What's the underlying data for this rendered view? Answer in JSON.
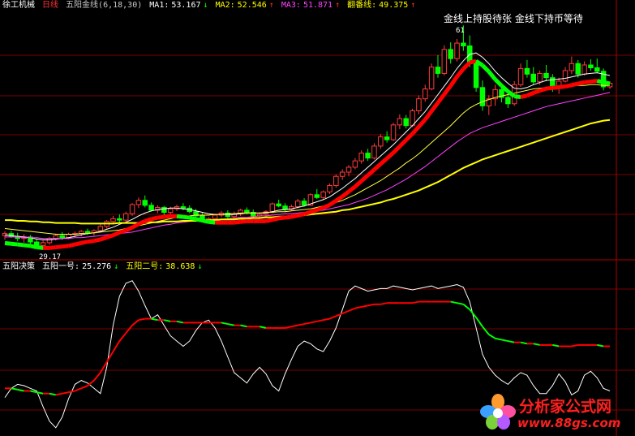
{
  "header_main": {
    "stock_name": "徐工机械",
    "period": "日线",
    "indicator": "五阳金线(6,18,30)",
    "ma1_label": "MA1:",
    "ma1_value": "53.167",
    "ma1_arrow": "↓",
    "ma2_label": "MA2:",
    "ma2_value": "52.546",
    "ma2_arrow": "↑",
    "ma3_label": "MA3:",
    "ma3_value": "51.871",
    "ma3_arrow": "↑",
    "fan_label": "翻番线:",
    "fan_value": "49.375",
    "fan_arrow": "↑"
  },
  "header_sub": {
    "indicator": "五阳决策",
    "line1_label": "五阳一号:",
    "line1_value": "25.276",
    "line1_arrow": "↓",
    "line2_label": "五阳二号:",
    "line2_value": "38.638",
    "line2_arrow": "↓"
  },
  "annotation": "金线上持股待张  金线下持币等待",
  "price_high_label": "61",
  "price_low_label": "29.17",
  "brand": {
    "name": "分析家公式网",
    "url": "www.88gs.com"
  },
  "colors": {
    "bg": "#000000",
    "up": "#ff3b3b",
    "down": "#00ff00",
    "gold_up": "#ff0000",
    "gold_down": "#00ff00",
    "ma1": "#ffffff",
    "ma2": "#ffff40",
    "ma3": "#ff40ff",
    "fan": "#ffff00",
    "grid": "#7a0000",
    "sub_white": "#ffffff"
  },
  "chart_data": [
    {
      "type": "candlestick",
      "title": "五阳金线(6,18,30)",
      "ylim": [
        28,
        63
      ],
      "grid": true,
      "candles": [
        [
          31.2,
          31.8,
          30.6,
          31.5
        ],
        [
          31.5,
          31.9,
          30.9,
          31.1
        ],
        [
          31.1,
          31.6,
          30.4,
          30.8
        ],
        [
          30.8,
          31.4,
          30.2,
          31.0
        ],
        [
          31.0,
          31.3,
          29.9,
          30.3
        ],
        [
          30.3,
          30.7,
          29.5,
          29.8
        ],
        [
          29.8,
          30.5,
          29.2,
          30.2
        ],
        [
          30.2,
          31.0,
          29.9,
          30.8
        ],
        [
          30.8,
          31.5,
          30.5,
          31.2
        ],
        [
          31.2,
          31.7,
          30.6,
          30.9
        ],
        [
          30.9,
          31.6,
          30.7,
          31.4
        ],
        [
          31.4,
          31.8,
          31.0,
          31.5
        ],
        [
          31.5,
          32.0,
          31.1,
          31.8
        ],
        [
          31.8,
          32.2,
          31.3,
          31.6
        ],
        [
          31.6,
          32.1,
          31.2,
          31.9
        ],
        [
          31.9,
          32.8,
          31.7,
          32.5
        ],
        [
          32.5,
          33.4,
          32.2,
          33.2
        ],
        [
          33.2,
          34.0,
          32.8,
          33.6
        ],
        [
          33.6,
          34.2,
          33.0,
          33.4
        ],
        [
          33.4,
          34.6,
          33.2,
          34.3
        ],
        [
          34.3,
          35.8,
          34.0,
          35.6
        ],
        [
          35.6,
          36.6,
          35.1,
          36.2
        ],
        [
          36.2,
          36.9,
          35.2,
          35.5
        ],
        [
          35.5,
          35.9,
          34.6,
          34.8
        ],
        [
          34.8,
          35.5,
          34.4,
          35.2
        ],
        [
          35.2,
          35.4,
          34.1,
          34.5
        ],
        [
          34.5,
          35.3,
          34.2,
          35.0
        ],
        [
          35.0,
          35.6,
          34.7,
          35.3
        ],
        [
          35.3,
          35.8,
          34.8,
          35.1
        ],
        [
          35.1,
          35.5,
          34.4,
          34.6
        ],
        [
          34.6,
          35.0,
          33.8,
          34.0
        ],
        [
          34.0,
          34.4,
          33.1,
          33.4
        ],
        [
          33.4,
          33.8,
          32.9,
          33.6
        ],
        [
          33.6,
          34.3,
          33.3,
          34.1
        ],
        [
          34.1,
          34.7,
          33.8,
          34.4
        ],
        [
          34.4,
          34.8,
          33.7,
          33.9
        ],
        [
          33.9,
          34.6,
          33.6,
          34.3
        ],
        [
          34.3,
          35.0,
          34.0,
          34.8
        ],
        [
          34.8,
          35.2,
          34.2,
          34.5
        ],
        [
          34.5,
          34.9,
          33.8,
          34.0
        ],
        [
          34.0,
          34.5,
          33.6,
          34.2
        ],
        [
          34.2,
          34.8,
          33.9,
          34.6
        ],
        [
          34.6,
          35.9,
          34.4,
          35.7
        ],
        [
          35.7,
          36.3,
          35.2,
          35.4
        ],
        [
          35.4,
          35.8,
          34.6,
          34.9
        ],
        [
          34.9,
          35.6,
          34.7,
          35.3
        ],
        [
          35.3,
          36.4,
          35.1,
          36.1
        ],
        [
          36.1,
          36.5,
          35.3,
          35.5
        ],
        [
          35.5,
          37.2,
          35.4,
          37.0
        ],
        [
          37.0,
          37.8,
          36.4,
          36.6
        ],
        [
          36.6,
          37.6,
          36.3,
          37.4
        ],
        [
          37.4,
          38.6,
          37.1,
          38.3
        ],
        [
          38.3,
          39.9,
          38.0,
          39.6
        ],
        [
          39.6,
          40.6,
          39.1,
          40.2
        ],
        [
          40.2,
          41.2,
          39.6,
          40.9
        ],
        [
          40.9,
          42.2,
          40.6,
          41.8
        ],
        [
          41.8,
          43.3,
          41.4,
          42.9
        ],
        [
          42.9,
          43.5,
          41.8,
          42.2
        ],
        [
          42.2,
          44.3,
          42.0,
          43.9
        ],
        [
          43.9,
          45.6,
          43.5,
          45.2
        ],
        [
          45.2,
          46.0,
          44.4,
          44.8
        ],
        [
          44.8,
          47.2,
          44.6,
          46.9
        ],
        [
          46.9,
          48.4,
          46.3,
          47.8
        ],
        [
          47.8,
          48.3,
          46.4,
          46.8
        ],
        [
          46.8,
          49.2,
          46.6,
          48.9
        ],
        [
          48.9,
          51.1,
          48.4,
          50.6
        ],
        [
          50.6,
          52.6,
          50.2,
          52.0
        ],
        [
          52.0,
          55.6,
          51.8,
          55.1
        ],
        [
          55.1,
          56.8,
          53.6,
          54.2
        ],
        [
          54.2,
          58.2,
          53.9,
          57.6
        ],
        [
          57.6,
          58.6,
          55.6,
          56.3
        ],
        [
          56.3,
          59.1,
          55.9,
          58.5
        ],
        [
          58.5,
          61.0,
          57.4,
          58.1
        ],
        [
          58.1,
          59.6,
          55.1,
          55.6
        ],
        [
          55.6,
          56.1,
          51.6,
          52.2
        ],
        [
          52.2,
          53.2,
          48.9,
          49.6
        ],
        [
          49.6,
          51.1,
          48.3,
          50.6
        ],
        [
          50.6,
          52.6,
          49.6,
          51.9
        ],
        [
          51.9,
          52.3,
          50.1,
          50.8
        ],
        [
          50.8,
          51.6,
          49.3,
          49.9
        ],
        [
          49.9,
          53.1,
          49.6,
          52.6
        ],
        [
          52.6,
          55.6,
          52.3,
          54.9
        ],
        [
          54.9,
          56.1,
          53.6,
          54.1
        ],
        [
          54.1,
          55.1,
          52.6,
          53.0
        ],
        [
          53.0,
          54.6,
          52.6,
          54.2
        ],
        [
          54.2,
          55.4,
          53.1,
          53.6
        ],
        [
          53.6,
          54.1,
          51.6,
          52.1
        ],
        [
          52.1,
          53.6,
          51.3,
          53.1
        ],
        [
          53.1,
          55.1,
          52.9,
          54.6
        ],
        [
          54.6,
          56.6,
          54.1,
          55.6
        ],
        [
          55.6,
          56.1,
          53.6,
          54.1
        ],
        [
          54.1,
          55.9,
          53.9,
          55.4
        ],
        [
          55.4,
          56.2,
          54.6,
          55.0
        ],
        [
          55.0,
          56.3,
          54.2,
          54.5
        ],
        [
          54.5,
          54.9,
          51.8,
          52.3
        ],
        [
          52.3,
          53.1,
          52.0,
          52.8
        ]
      ],
      "series": [
        {
          "name": "MA1",
          "values": [
            31.3,
            31.2,
            31.1,
            31.0,
            30.9,
            30.7,
            30.6,
            30.6,
            30.7,
            30.8,
            30.9,
            31.1,
            31.3,
            31.5,
            31.6,
            31.8,
            32.1,
            32.4,
            32.8,
            33.1,
            33.5,
            34.0,
            34.4,
            34.7,
            34.9,
            35.0,
            35.1,
            35.1,
            35.0,
            34.9,
            34.7,
            34.5,
            34.3,
            34.2,
            34.2,
            34.2,
            34.2,
            34.3,
            34.4,
            34.4,
            34.4,
            34.4,
            34.6,
            34.8,
            34.9,
            35.0,
            35.2,
            35.4,
            35.7,
            36.0,
            36.3,
            36.7,
            37.3,
            37.9,
            38.6,
            39.3,
            40.1,
            40.9,
            41.7,
            42.5,
            43.3,
            44.1,
            45.0,
            45.9,
            46.8,
            47.8,
            48.8,
            50.0,
            51.2,
            52.4,
            53.6,
            54.9,
            56.0,
            56.9,
            57.1,
            56.5,
            55.6,
            54.5,
            53.6,
            52.8,
            52.1,
            52.0,
            52.2,
            52.6,
            52.9,
            53.2,
            53.3,
            53.4,
            53.5,
            53.7,
            53.9,
            54.1,
            54.2,
            54.3,
            54.1,
            53.9
          ]
        },
        {
          "name": "MA2",
          "values": [
            32.2,
            32.1,
            32.0,
            31.9,
            31.8,
            31.7,
            31.6,
            31.5,
            31.4,
            31.4,
            31.4,
            31.4,
            31.5,
            31.5,
            31.6,
            31.7,
            31.8,
            31.9,
            32.0,
            32.2,
            32.4,
            32.6,
            32.8,
            33.0,
            33.2,
            33.4,
            33.6,
            33.8,
            33.9,
            34.0,
            34.1,
            34.1,
            34.1,
            34.2,
            34.2,
            34.3,
            34.3,
            34.4,
            34.4,
            34.4,
            34.4,
            34.5,
            34.5,
            34.6,
            34.6,
            34.7,
            34.8,
            34.9,
            35.0,
            35.2,
            35.4,
            35.6,
            35.9,
            36.2,
            36.6,
            37.0,
            37.5,
            38.0,
            38.5,
            39.0,
            39.6,
            40.2,
            40.8,
            41.5,
            42.1,
            42.8,
            43.6,
            44.4,
            45.2,
            46.0,
            46.8,
            47.7,
            48.6,
            49.3,
            49.8,
            50.2,
            50.5,
            50.8,
            51.0,
            51.2,
            51.4,
            51.6,
            51.8,
            52.0,
            52.1,
            52.2,
            52.3,
            52.3,
            52.4,
            52.4,
            52.5,
            52.5,
            52.6,
            52.6,
            52.5,
            52.5
          ]
        },
        {
          "name": "MA3",
          "values": [
            31.0,
            31.0,
            31.0,
            30.9,
            30.9,
            30.9,
            30.8,
            30.8,
            30.8,
            30.8,
            30.8,
            30.9,
            30.9,
            31.0,
            31.1,
            31.2,
            31.3,
            31.4,
            31.5,
            31.6,
            31.7,
            31.9,
            32.1,
            32.3,
            32.5,
            32.7,
            32.8,
            33.0,
            33.1,
            33.2,
            33.3,
            33.3,
            33.4,
            33.5,
            33.5,
            33.6,
            33.7,
            33.8,
            33.8,
            33.9,
            34.0,
            34.0,
            34.1,
            34.2,
            34.3,
            34.3,
            34.4,
            34.5,
            34.6,
            34.7,
            34.8,
            35.0,
            35.2,
            35.4,
            35.6,
            35.9,
            36.2,
            36.5,
            36.9,
            37.3,
            37.7,
            38.2,
            38.7,
            39.2,
            39.8,
            40.4,
            41.0,
            41.7,
            42.4,
            43.1,
            43.8,
            44.5,
            45.1,
            45.7,
            46.1,
            46.5,
            46.8,
            47.1,
            47.4,
            47.7,
            48.0,
            48.3,
            48.6,
            48.9,
            49.2,
            49.5,
            49.7,
            49.9,
            50.1,
            50.3,
            50.5,
            50.7,
            50.9,
            51.1,
            51.3,
            51.5
          ]
        },
        {
          "name": "翻番线",
          "values": [
            33.4,
            33.4,
            33.3,
            33.3,
            33.2,
            33.2,
            33.1,
            33.1,
            33.0,
            33.0,
            33.0,
            33.0,
            32.9,
            32.9,
            32.9,
            32.9,
            32.9,
            32.9,
            33.0,
            33.0,
            33.0,
            33.0,
            33.1,
            33.1,
            33.1,
            33.2,
            33.2,
            33.2,
            33.3,
            33.3,
            33.3,
            33.4,
            33.4,
            33.4,
            33.5,
            33.5,
            33.5,
            33.6,
            33.6,
            33.7,
            33.7,
            33.8,
            33.8,
            33.9,
            33.9,
            34.0,
            34.0,
            34.1,
            34.2,
            34.3,
            34.4,
            34.5,
            34.6,
            34.8,
            34.9,
            35.1,
            35.3,
            35.5,
            35.7,
            35.9,
            36.2,
            36.4,
            36.7,
            37.0,
            37.3,
            37.6,
            38.0,
            38.4,
            38.8,
            39.3,
            39.8,
            40.3,
            40.8,
            41.2,
            41.6,
            42.0,
            42.3,
            42.6,
            42.9,
            43.2,
            43.5,
            43.8,
            44.1,
            44.4,
            44.7,
            45.0,
            45.3,
            45.6,
            45.9,
            46.2,
            46.5,
            46.8,
            47.1,
            47.3,
            47.5,
            47.6
          ]
        }
      ]
    },
    {
      "type": "line",
      "title": "五阳决策",
      "ylim": [
        -10,
        110
      ],
      "grid": true,
      "series": [
        {
          "name": "五阳一号",
          "values": [
            15,
            22,
            25,
            24,
            22,
            20,
            8,
            -3,
            -8,
            0,
            14,
            25,
            28,
            26,
            22,
            18,
            38,
            70,
            92,
            102,
            104,
            96,
            85,
            75,
            78,
            70,
            62,
            58,
            54,
            58,
            66,
            72,
            74,
            68,
            58,
            46,
            34,
            30,
            26,
            33,
            38,
            33,
            24,
            20,
            33,
            44,
            54,
            58,
            56,
            52,
            50,
            58,
            68,
            82,
            96,
            100,
            98,
            96,
            97,
            98,
            98,
            100,
            99,
            98,
            97,
            98,
            99,
            100,
            98,
            99,
            100,
            101,
            99,
            88,
            68,
            48,
            38,
            32,
            28,
            25,
            30,
            34,
            32,
            24,
            18,
            18,
            24,
            33,
            27,
            17,
            20,
            32,
            35,
            30,
            22,
            20
          ]
        },
        {
          "name": "五阳二号",
          "values": [
            22,
            22,
            21,
            20,
            20,
            19,
            18,
            18,
            17,
            18,
            19,
            20,
            22,
            24,
            28,
            34,
            42,
            50,
            58,
            64,
            70,
            74,
            75,
            75,
            74,
            74,
            73,
            73,
            72,
            72,
            72,
            72,
            72,
            72,
            72,
            71,
            70,
            70,
            69,
            69,
            69,
            68,
            68,
            68,
            68,
            69,
            70,
            71,
            72,
            73,
            74,
            75,
            77,
            79,
            81,
            83,
            84,
            85,
            86,
            86,
            87,
            87,
            87,
            87,
            87,
            88,
            88,
            88,
            88,
            88,
            88,
            87,
            86,
            82,
            76,
            69,
            63,
            60,
            59,
            58,
            57,
            57,
            56,
            56,
            55,
            55,
            55,
            54,
            54,
            54,
            55,
            55,
            55,
            55,
            54,
            54
          ]
        }
      ]
    }
  ]
}
